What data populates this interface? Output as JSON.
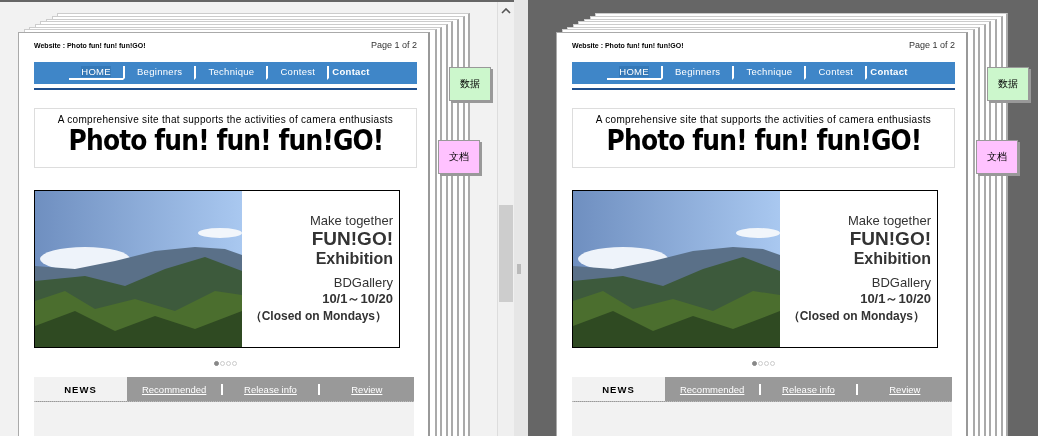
{
  "panes": [
    {
      "header_title": "Website : Photo fun! fun! fun!GO!",
      "page_count": "Page 1 of 2",
      "nav": [
        {
          "label": "HOME",
          "selected": true,
          "kind": "normal"
        },
        {
          "label": "Beginners",
          "selected": false,
          "kind": "normal"
        },
        {
          "label": "Technique",
          "selected": false,
          "kind": "normal"
        },
        {
          "label": "Contest",
          "selected": false,
          "kind": "normal"
        },
        {
          "label": "Contact",
          "selected": false,
          "kind": "bold"
        }
      ],
      "tagline": "A comprehensive site that supports the activities of camera enthusiasts",
      "site_title": "Photo fun! fun! fun!GO!",
      "hero": [
        "Make together",
        "FUN!GO!",
        "Exhibition",
        "BDGallery",
        "10/1～10/20",
        "（Closed on Mondays）"
      ],
      "dots": [
        {
          "selected": true
        },
        {
          "selected": false
        },
        {
          "selected": false
        },
        {
          "selected": false
        }
      ],
      "news_tabs": [
        {
          "label": "NEWS",
          "selected": true
        },
        {
          "label": "Recommended",
          "selected": false
        },
        {
          "label": "Release info",
          "selected": false
        },
        {
          "label": "Review",
          "selected": false
        }
      ],
      "side_tabs": [
        {
          "label": "数据",
          "color": "#ccf7cc"
        },
        {
          "label": "文档",
          "color": "#ffc2ff"
        }
      ]
    },
    {
      "header_title": "Website : Photo fun! fun! fun!GO!",
      "page_count": "Page 1 of 2",
      "nav": [
        {
          "label": "HOME",
          "selected": true,
          "kind": "normal"
        },
        {
          "label": "Beginners",
          "selected": false,
          "kind": "normal"
        },
        {
          "label": "Technique",
          "selected": false,
          "kind": "normal"
        },
        {
          "label": "Contest",
          "selected": false,
          "kind": "normal"
        },
        {
          "label": "Contact",
          "selected": false,
          "kind": "bold"
        }
      ],
      "tagline": "A comprehensive site that supports the activities of camera enthusiasts",
      "site_title": "Photo fun! fun! fun!GO!",
      "hero": [
        "Make together",
        "FUN!GO!",
        "Exhibition",
        "BDGallery",
        "10/1～10/20",
        "（Closed on Mondays）"
      ],
      "dots": [
        {
          "selected": true
        },
        {
          "selected": false
        },
        {
          "selected": false
        },
        {
          "selected": false
        }
      ],
      "news_tabs": [
        {
          "label": "NEWS",
          "selected": true
        },
        {
          "label": "Recommended",
          "selected": false
        },
        {
          "label": "Release info",
          "selected": false
        },
        {
          "label": "Review",
          "selected": false
        }
      ],
      "side_tabs": [
        {
          "label": "数据",
          "color": "#ccf7cc"
        },
        {
          "label": "文档",
          "color": "#ffc2ff"
        }
      ]
    }
  ]
}
